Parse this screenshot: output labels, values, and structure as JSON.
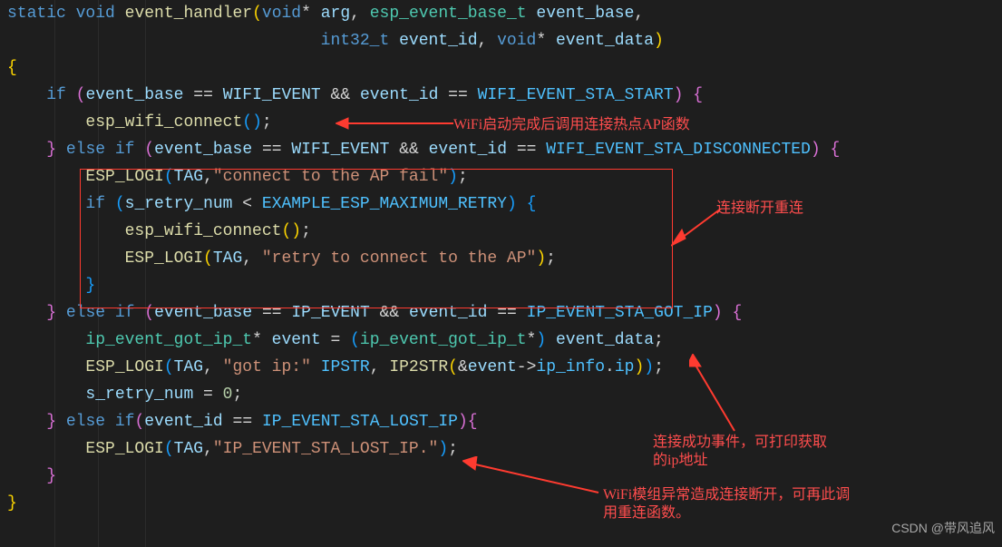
{
  "lines": [
    {
      "tokens": [
        [
          "kw",
          "static"
        ],
        [
          "pun",
          " "
        ],
        [
          "kw",
          "void"
        ],
        [
          "pun",
          " "
        ],
        [
          "fn",
          "event_handler"
        ],
        [
          "brace3",
          "("
        ],
        [
          "kw",
          "void"
        ],
        [
          "pun",
          "* "
        ],
        [
          "var",
          "arg"
        ],
        [
          "pun",
          ", "
        ],
        [
          "type",
          "esp_event_base_t"
        ],
        [
          "pun",
          " "
        ],
        [
          "var",
          "event_base"
        ],
        [
          "pun",
          ","
        ]
      ]
    },
    {
      "tokens": [
        [
          "pun",
          "                                "
        ],
        [
          "kw",
          "int32_t"
        ],
        [
          "pun",
          " "
        ],
        [
          "var",
          "event_id"
        ],
        [
          "pun",
          ", "
        ],
        [
          "kw",
          "void"
        ],
        [
          "pun",
          "* "
        ],
        [
          "var",
          "event_data"
        ],
        [
          "brace3",
          ")"
        ]
      ]
    },
    {
      "tokens": [
        [
          "brace3",
          "{"
        ]
      ]
    },
    {
      "tokens": [
        [
          "pun",
          "    "
        ],
        [
          "kw",
          "if"
        ],
        [
          "pun",
          " "
        ],
        [
          "brace",
          "("
        ],
        [
          "var",
          "event_base"
        ],
        [
          "pun",
          " == "
        ],
        [
          "var",
          "WIFI_EVENT"
        ],
        [
          "pun",
          " && "
        ],
        [
          "var",
          "event_id"
        ],
        [
          "pun",
          " == "
        ],
        [
          "const",
          "WIFI_EVENT_STA_START"
        ],
        [
          "brace",
          ")"
        ],
        [
          "pun",
          " "
        ],
        [
          "brace",
          "{"
        ]
      ]
    },
    {
      "tokens": [
        [
          "pun",
          "        "
        ],
        [
          "fn",
          "esp_wifi_connect"
        ],
        [
          "brace2",
          "("
        ],
        [
          "brace2",
          ")"
        ],
        [
          "pun",
          ";"
        ]
      ]
    },
    {
      "tokens": [
        [
          "pun",
          "    "
        ],
        [
          "brace",
          "}"
        ],
        [
          "pun",
          " "
        ],
        [
          "kw",
          "else"
        ],
        [
          "pun",
          " "
        ],
        [
          "kw",
          "if"
        ],
        [
          "pun",
          " "
        ],
        [
          "brace",
          "("
        ],
        [
          "var",
          "event_base"
        ],
        [
          "pun",
          " == "
        ],
        [
          "var",
          "WIFI_EVENT"
        ],
        [
          "pun",
          " && "
        ],
        [
          "var",
          "event_id"
        ],
        [
          "pun",
          " == "
        ],
        [
          "const",
          "WIFI_EVENT_STA_DISCONNECTED"
        ],
        [
          "brace",
          ")"
        ],
        [
          "pun",
          " "
        ],
        [
          "brace",
          "{"
        ]
      ]
    },
    {
      "tokens": [
        [
          "pun",
          "        "
        ],
        [
          "fn",
          "ESP_LOGI"
        ],
        [
          "brace2",
          "("
        ],
        [
          "var",
          "TAG"
        ],
        [
          "pun",
          ","
        ],
        [
          "str",
          "\"connect to the AP fail\""
        ],
        [
          "brace2",
          ")"
        ],
        [
          "pun",
          ";"
        ]
      ]
    },
    {
      "tokens": [
        [
          "pun",
          "        "
        ],
        [
          "kw",
          "if"
        ],
        [
          "pun",
          " "
        ],
        [
          "brace2",
          "("
        ],
        [
          "var",
          "s_retry_num"
        ],
        [
          "pun",
          " < "
        ],
        [
          "const",
          "EXAMPLE_ESP_MAXIMUM_RETRY"
        ],
        [
          "brace2",
          ")"
        ],
        [
          "pun",
          " "
        ],
        [
          "brace2",
          "{"
        ]
      ]
    },
    {
      "tokens": [
        [
          "pun",
          "            "
        ],
        [
          "fn",
          "esp_wifi_connect"
        ],
        [
          "brace3",
          "("
        ],
        [
          "brace3",
          ")"
        ],
        [
          "pun",
          ";"
        ]
      ]
    },
    {
      "tokens": [
        [
          "pun",
          "            "
        ],
        [
          "fn",
          "ESP_LOGI"
        ],
        [
          "brace3",
          "("
        ],
        [
          "var",
          "TAG"
        ],
        [
          "pun",
          ", "
        ],
        [
          "str",
          "\"retry to connect to the AP\""
        ],
        [
          "brace3",
          ")"
        ],
        [
          "pun",
          ";"
        ]
      ]
    },
    {
      "tokens": [
        [
          "pun",
          "        "
        ],
        [
          "brace2",
          "}"
        ]
      ]
    },
    {
      "tokens": [
        [
          "pun",
          "    "
        ],
        [
          "brace",
          "}"
        ],
        [
          "pun",
          " "
        ],
        [
          "kw",
          "else"
        ],
        [
          "pun",
          " "
        ],
        [
          "kw",
          "if"
        ],
        [
          "pun",
          " "
        ],
        [
          "brace",
          "("
        ],
        [
          "var",
          "event_base"
        ],
        [
          "pun",
          " == "
        ],
        [
          "var",
          "IP_EVENT"
        ],
        [
          "pun",
          " && "
        ],
        [
          "var",
          "event_id"
        ],
        [
          "pun",
          " == "
        ],
        [
          "const",
          "IP_EVENT_STA_GOT_IP"
        ],
        [
          "brace",
          ")"
        ],
        [
          "pun",
          " "
        ],
        [
          "brace",
          "{"
        ]
      ]
    },
    {
      "tokens": [
        [
          "pun",
          "        "
        ],
        [
          "type",
          "ip_event_got_ip_t"
        ],
        [
          "pun",
          "* "
        ],
        [
          "var",
          "event"
        ],
        [
          "pun",
          " = "
        ],
        [
          "brace2",
          "("
        ],
        [
          "type",
          "ip_event_got_ip_t"
        ],
        [
          "pun",
          "*"
        ],
        [
          "brace2",
          ")"
        ],
        [
          "pun",
          " "
        ],
        [
          "var",
          "event_data"
        ],
        [
          "pun",
          ";"
        ]
      ]
    },
    {
      "tokens": [
        [
          "pun",
          "        "
        ],
        [
          "fn",
          "ESP_LOGI"
        ],
        [
          "brace2",
          "("
        ],
        [
          "var",
          "TAG"
        ],
        [
          "pun",
          ", "
        ],
        [
          "str",
          "\"got ip:\""
        ],
        [
          "pun",
          " "
        ],
        [
          "const",
          "IPSTR"
        ],
        [
          "pun",
          ", "
        ],
        [
          "fn",
          "IP2STR"
        ],
        [
          "brace3",
          "("
        ],
        [
          "pun",
          "&"
        ],
        [
          "var",
          "event"
        ],
        [
          "pun",
          "->"
        ],
        [
          "const",
          "ip_info"
        ],
        [
          "pun",
          "."
        ],
        [
          "const",
          "ip"
        ],
        [
          "brace3",
          ")"
        ],
        [
          "brace2",
          ")"
        ],
        [
          "pun",
          ";"
        ]
      ]
    },
    {
      "tokens": [
        [
          "pun",
          "        "
        ],
        [
          "var",
          "s_retry_num"
        ],
        [
          "pun",
          " = "
        ],
        [
          "num",
          "0"
        ],
        [
          "pun",
          ";"
        ]
      ]
    },
    {
      "tokens": [
        [
          "pun",
          "    "
        ],
        [
          "brace",
          "}"
        ],
        [
          "pun",
          " "
        ],
        [
          "kw",
          "else"
        ],
        [
          "pun",
          " "
        ],
        [
          "kw",
          "if"
        ],
        [
          "brace",
          "("
        ],
        [
          "var",
          "event_id"
        ],
        [
          "pun",
          " == "
        ],
        [
          "const",
          "IP_EVENT_STA_LOST_IP"
        ],
        [
          "brace",
          ")"
        ],
        [
          "brace",
          "{"
        ]
      ]
    },
    {
      "tokens": [
        [
          "pun",
          "        "
        ],
        [
          "fn",
          "ESP_LOGI"
        ],
        [
          "brace2",
          "("
        ],
        [
          "var",
          "TAG"
        ],
        [
          "pun",
          ","
        ],
        [
          "str",
          "\"IP_EVENT_STA_LOST_IP.\""
        ],
        [
          "brace2",
          ")"
        ],
        [
          "pun",
          ";"
        ]
      ]
    },
    {
      "tokens": [
        [
          "pun",
          "    "
        ],
        [
          "brace",
          "}"
        ]
      ]
    },
    {
      "tokens": [
        [
          "brace3",
          "}"
        ]
      ]
    }
  ],
  "annotations": {
    "a1": "WiFi启动完成后调用连接热点AP函数",
    "a2": "连接断开重连",
    "a3": "连接成功事件，可打印获取\n的ip地址",
    "a4": "WiFi模组异常造成连接断开，可再此调\n用重连函数。"
  },
  "watermark": "CSDN @带风追风"
}
